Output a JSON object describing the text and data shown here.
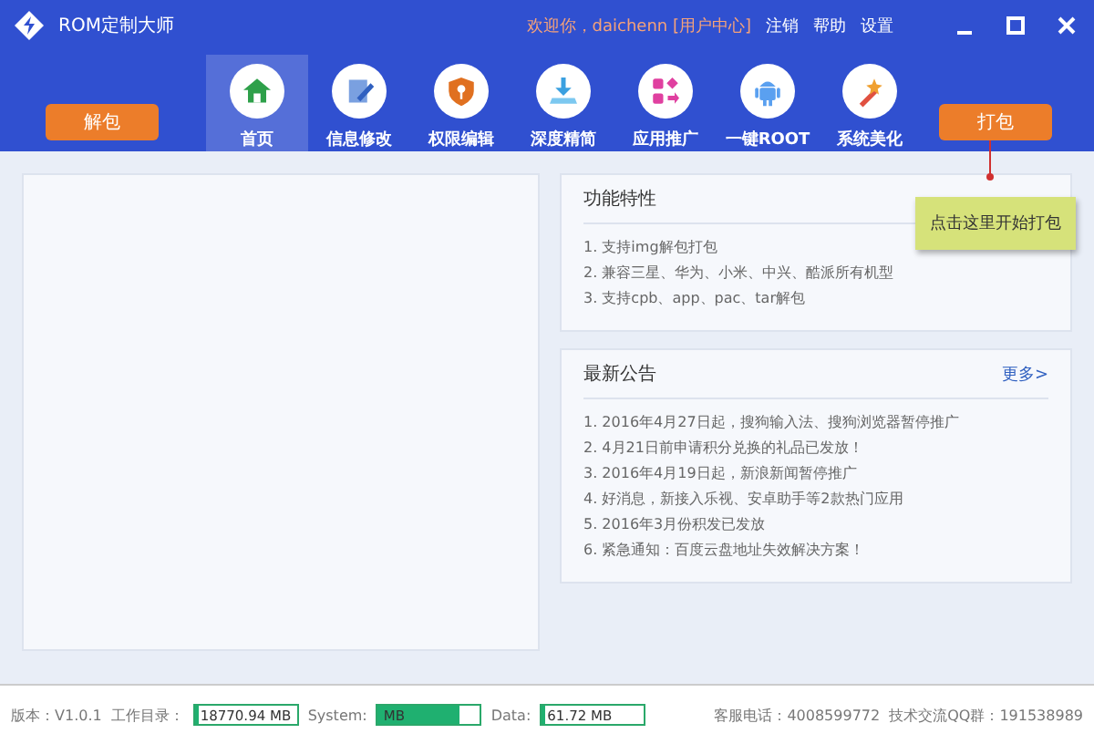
{
  "window": {
    "title": "ROM定制大师",
    "greeting": "欢迎你，daichenn [用户中心]",
    "menu": [
      "注销",
      "帮助",
      "设置"
    ]
  },
  "toolbar": {
    "left_button": "解包",
    "right_button": "打包",
    "nav": [
      {
        "label": "首页",
        "selected": true
      },
      {
        "label": "信息修改",
        "selected": false
      },
      {
        "label": "权限编辑",
        "selected": false
      },
      {
        "label": "深度精简",
        "selected": false
      },
      {
        "label": "应用推广",
        "selected": false
      },
      {
        "label": "一键ROOT",
        "selected": false
      },
      {
        "label": "系统美化",
        "selected": false
      }
    ]
  },
  "tooltip": "点击这里开始打包",
  "features": {
    "title": "功能特性",
    "items": [
      "1. 支持img解包打包",
      "2. 兼容三星、华为、小米、中兴、酷派所有机型",
      "3. 支持cpb、app、pac、tar解包"
    ]
  },
  "news": {
    "title": "最新公告",
    "more": "更多>",
    "items": [
      "1. 2016年4月27日起，搜狗输入法、搜狗浏览器暂停推广",
      "2. 4月21日前申请积分兑换的礼品已发放！",
      "3. 2016年4月19日起，新浪新闻暂停推广",
      "4. 好消息，新接入乐视、安卓助手等2款热门应用",
      "5. 2016年3月份积发已发放",
      "6. 紧急通知：百度云盘地址失效解决方案！"
    ]
  },
  "status_bar": {
    "version": "版本：V1.0.1",
    "meters": [
      {
        "label": "工作目录：",
        "value": "18770.94 MB",
        "level": 0.03
      },
      {
        "label": "System:",
        "value": "MB",
        "level": 0.8
      },
      {
        "label": "Data:",
        "value": "61.72 MB",
        "level": 0.03
      }
    ],
    "phone": "客服电话：4008599772",
    "qq": "技术交流QQ群：191538989"
  }
}
